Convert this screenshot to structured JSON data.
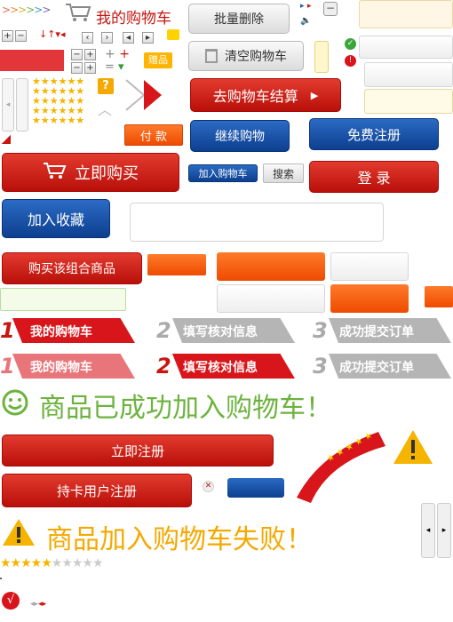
{
  "colors": {
    "red": "#c8160f",
    "blue": "#0d3f8f",
    "orange": "#f25a00",
    "green": "#6cb33e",
    "yellow": "#ffb400"
  },
  "header": {
    "my_cart": "我的购物车"
  },
  "buttons": {
    "batch_delete": "批量删除",
    "clear_cart": "清空购物车",
    "checkout": "去购物车结算",
    "continue_shopping": "继续购物",
    "free_register": "免费注册",
    "buy_now": "立即购买",
    "add_to_cart": "加入购物车",
    "search": "搜索",
    "login": "登 录",
    "add_favorite": "加入收藏",
    "buy_combo": "购买该组合商品",
    "pay": "付 款",
    "register_now": "立即注册",
    "card_register": "持卡用户注册"
  },
  "badges": {
    "gift": "赠品",
    "help": "?"
  },
  "steps_row1": [
    {
      "num": "1",
      "label": "我的购物车"
    },
    {
      "num": "2",
      "label": "填写核对信息"
    },
    {
      "num": "3",
      "label": "成功提交订单"
    }
  ],
  "steps_row2": [
    {
      "num": "1",
      "label": "我的购物车"
    },
    {
      "num": "2",
      "label": "填写核对信息"
    },
    {
      "num": "3",
      "label": "成功提交订单"
    }
  ],
  "messages": {
    "success": "商品已成功加入购物车！",
    "fail": "商品加入购物车失败！"
  },
  "icons": {
    "smile": "smile-icon",
    "warning": "warning-icon",
    "cart": "cart-icon",
    "trash": "trash-icon",
    "check": "check-icon",
    "error": "error-icon"
  }
}
